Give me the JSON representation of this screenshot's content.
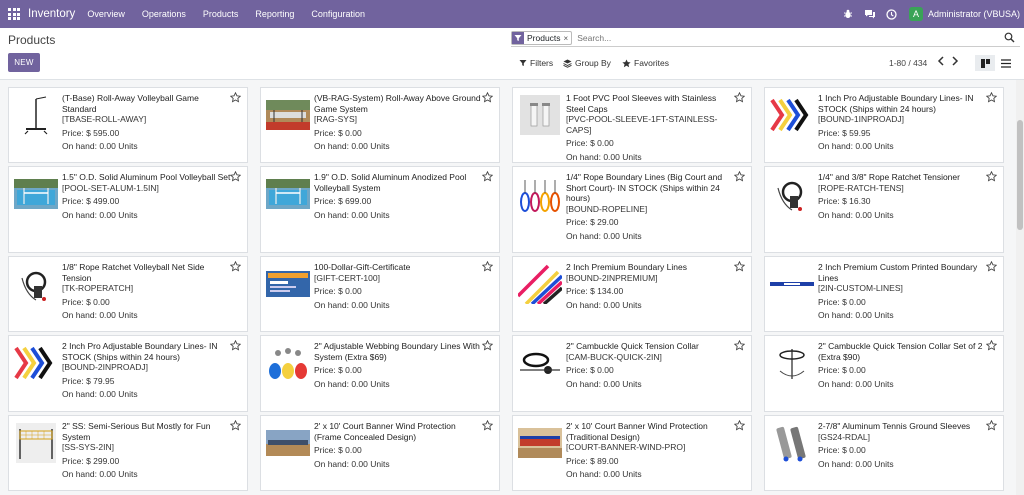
{
  "navbar": {
    "app_name": "Inventory",
    "menu": [
      "Overview",
      "Operations",
      "Products",
      "Reporting",
      "Configuration"
    ],
    "user": {
      "initial": "A",
      "name": "Administrator (VBUSA)"
    },
    "colors": {
      "brand": "#71639e",
      "avatar": "#3aa357"
    }
  },
  "control": {
    "title": "Products",
    "new_label": "NEW",
    "facet_label": "Products",
    "facet_remove": "×",
    "search_placeholder": "Search...",
    "filters_label": "Filters",
    "groupby_label": "Group By",
    "favorites_label": "Favorites",
    "pager": "1-80 / 434"
  },
  "products": [
    {
      "name": "(T-Base) Roll-Away Volleyball Game Standard",
      "code": "[TBASE-ROLL-AWAY]",
      "price": "Price: $ 595.00",
      "onhand": "On hand: 0.00 Units",
      "thumb": "stand"
    },
    {
      "name": "(VB-RAG-System) Roll-Away Above Ground Game System",
      "code": "[RAG-SYS]",
      "price": "Price: $ 0.00",
      "onhand": "On hand: 0.00 Units",
      "thumb": "court"
    },
    {
      "name": "1 Foot PVC Pool Sleeves with Stainless Steel Caps",
      "code": "[PVC-POOL-SLEEVE-1FT-STAINLESS-CAPS]",
      "price": "Price: $ 0.00",
      "onhand": "On hand: 0.00 Units",
      "thumb": "sleeves"
    },
    {
      "name": "1 Inch Pro Adjustable Boundary Lines- IN STOCK (Ships within 24 hours)",
      "code": "[BOUND-1INPROADJ]",
      "price": "Price: $ 59.95",
      "onhand": "On hand: 0.00 Units",
      "thumb": "chevrons"
    },
    {
      "name": "1.5\" O.D. Solid Aluminum Pool Volleyball Set",
      "code": "[POOL-SET-ALUM-1.5IN]",
      "price": "Price: $ 499.00",
      "onhand": "On hand: 0.00 Units",
      "thumb": "pool"
    },
    {
      "name": "1.9\" O.D. Solid Aluminum Anodized Pool Volleyball System",
      "code": "",
      "price": "Price: $ 699.00",
      "onhand": "On hand: 0.00 Units",
      "thumb": "pool"
    },
    {
      "name": "1/4\" Rope Boundary Lines (Big Court and Short Court)- IN STOCK (Ships within 24 hours)",
      "code": "[BOUND-ROPELINE]",
      "price": "Price: $ 29.00",
      "onhand": "On hand: 0.00 Units",
      "thumb": "ropes"
    },
    {
      "name": "1/4\" and 3/8\" Rope Ratchet Tensioner",
      "code": "[ROPE-RATCH-TENS]",
      "price": "Price: $ 16.30",
      "onhand": "On hand: 0.00 Units",
      "thumb": "ratchet"
    },
    {
      "name": "1/8\" Rope Ratchet Volleyball Net Side Tension",
      "code": "[TK-ROPERATCH]",
      "price": "Price: $ 0.00",
      "onhand": "On hand: 0.00 Units",
      "thumb": "ratchet"
    },
    {
      "name": "100-Dollar-Gift-Certificate",
      "code": "[GIFT-CERT-100]",
      "price": "Price: $ 0.00",
      "onhand": "On hand: 0.00 Units",
      "thumb": "gift"
    },
    {
      "name": "2 Inch Premium Boundary Lines",
      "code": "[BOUND-2INPREMIUM]",
      "price": "Price: $ 134.00",
      "onhand": "On hand: 0.00 Units",
      "thumb": "stripes"
    },
    {
      "name": "2 Inch Premium Custom Printed Boundary Lines",
      "code": "[2IN-CUSTOM-LINES]",
      "price": "Price: $ 0.00",
      "onhand": "On hand: 0.00 Units",
      "thumb": "blueline"
    },
    {
      "name": "2 Inch Pro Adjustable Boundary Lines- IN STOCK (Ships within 24 hours)",
      "code": "[BOUND-2INPROADJ]",
      "price": "Price: $ 79.95",
      "onhand": "On hand: 0.00 Units",
      "thumb": "chevrons"
    },
    {
      "name": "2\" Adjustable Webbing Boundary Lines With System (Extra $69)",
      "code": "",
      "price": "Price: $ 0.00",
      "onhand": "On hand: 0.00 Units",
      "thumb": "webbing"
    },
    {
      "name": "2\" Cambuckle Quick Tension Collar",
      "code": "[CAM-BUCK-QUICK-2IN]",
      "price": "Price: $ 0.00",
      "onhand": "On hand: 0.00 Units",
      "thumb": "collar"
    },
    {
      "name": "2\" Cambuckle Quick Tension Collar Set of 2 (Extra $90)",
      "code": "",
      "price": "Price: $ 0.00",
      "onhand": "On hand: 0.00 Units",
      "thumb": "collarset"
    },
    {
      "name": "2\" SS: Semi-Serious But Mostly for Fun System",
      "code": "[SS-SYS-2IN]",
      "price": "Price: $ 299.00",
      "onhand": "On hand: 0.00 Units",
      "thumb": "net"
    },
    {
      "name": "2' x 10' Court Banner Wind Protection (Frame Concealed Design)",
      "code": "",
      "price": "Price: $ 0.00",
      "onhand": "On hand: 0.00 Units",
      "thumb": "banner"
    },
    {
      "name": "2' x 10' Court Banner Wind Protection (Traditional Design)",
      "code": "[COURT-BANNER-WIND-PRO]",
      "price": "Price: $ 89.00",
      "onhand": "On hand: 0.00 Units",
      "thumb": "banner2"
    },
    {
      "name": "2-7/8\" Aluminum Tennis Ground Sleeves",
      "code": "[GS24-RDAL]",
      "price": "Price: $ 0.00",
      "onhand": "On hand: 0.00 Units",
      "thumb": "tubes"
    }
  ]
}
